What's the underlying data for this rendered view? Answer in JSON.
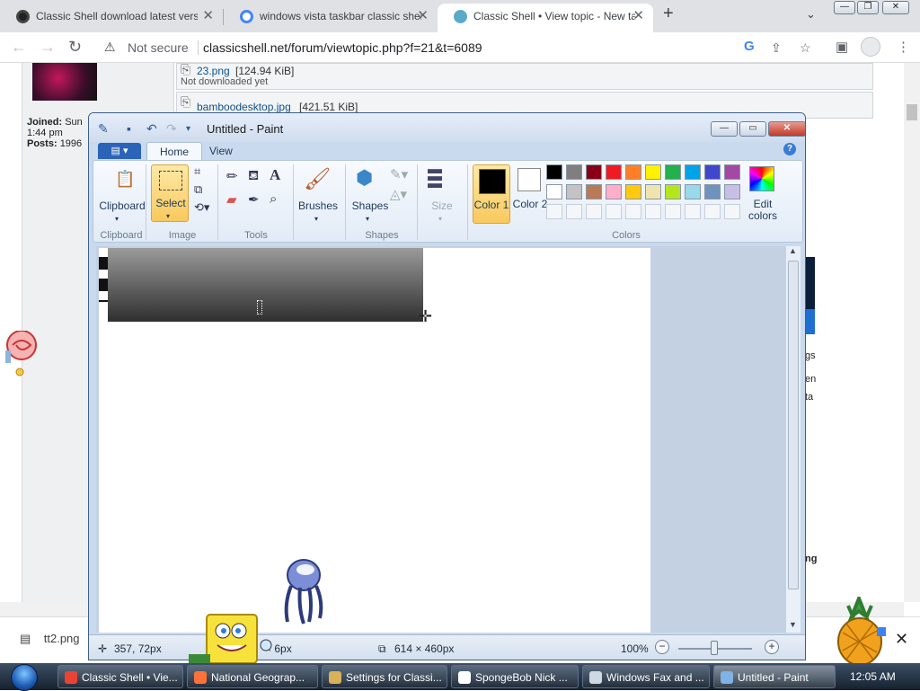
{
  "browser": {
    "tabs": [
      {
        "title": "Classic Shell download latest versio",
        "favicon_color": "#222222"
      },
      {
        "title": "windows vista taskbar classic shell -",
        "favicon_color": "#4285f4"
      },
      {
        "title": "Classic Shell • View topic - New task",
        "favicon_color": "#5aa9c9",
        "active": true
      }
    ],
    "security_label": "Not secure",
    "url": "classicshell.net/forum/viewtopic.php?f=21&t=6089",
    "google_icon_text": "G"
  },
  "forum": {
    "joined_label": "Joined:",
    "joined_value": "Sun",
    "joined_time": "1:44 pm",
    "posts_label": "Posts:",
    "posts_value": "1996",
    "attachment1_name": "23.png",
    "attachment1_size": "[124.94 KiB]",
    "attachment1_note": "Not downloaded yet",
    "attachment2_name": "bamboodesktop.jpg",
    "attachment2_size": "[421.51 KiB]",
    "right_fragments": [
      "gs",
      "en",
      "ta",
      "ng"
    ]
  },
  "paint": {
    "title": "Untitled - Paint",
    "app_menu_label": "▤ ▾",
    "tabs": [
      "Home",
      "View"
    ],
    "groups": {
      "clipboard": "Clipboard",
      "image": "Image",
      "tools": "Tools",
      "shapes": "Shapes",
      "colors": "Colors"
    },
    "buttons": {
      "clipboard": "Clipboard",
      "select": "Select",
      "brushes": "Brushes",
      "shapes": "Shapes",
      "size": "Size",
      "color1": "Color 1",
      "color2": "Color 2",
      "edit_colors": "Edit colors"
    },
    "palette_row1": [
      "#000000",
      "#7f7f7f",
      "#880015",
      "#ed1c24",
      "#ff7f27",
      "#fff200",
      "#22b14c",
      "#00a2e8",
      "#3f48cc",
      "#a349a4"
    ],
    "palette_row2": [
      "#ffffff",
      "#c3c3c3",
      "#b97a57",
      "#ffaec9",
      "#ffc90e",
      "#efe4b0",
      "#b5e61d",
      "#99d9ea",
      "#7092be",
      "#c8bfe7"
    ],
    "status": {
      "cursor_pos": "357, 72px",
      "selection_size": "× 6px",
      "canvas_size": "614 × 460px",
      "zoom": "100%"
    }
  },
  "downloads": {
    "file": "tt2.png"
  },
  "taskbar": {
    "items": [
      {
        "label": "Classic Shell • Vie...",
        "icon_color": "#ea4335"
      },
      {
        "label": "National Geograp...",
        "icon_color": "#ff7139"
      },
      {
        "label": "Settings for Classi...",
        "icon_color": "#d8b15a"
      },
      {
        "label": "SpongeBob Nick ...",
        "icon_color": "#ffffff"
      },
      {
        "label": "Windows Fax and ...",
        "icon_color": "#cfd8e3"
      },
      {
        "label": "Untitled - Paint",
        "icon_color": "#7fb2e5",
        "active": true
      }
    ],
    "clock": "12:05 AM"
  }
}
